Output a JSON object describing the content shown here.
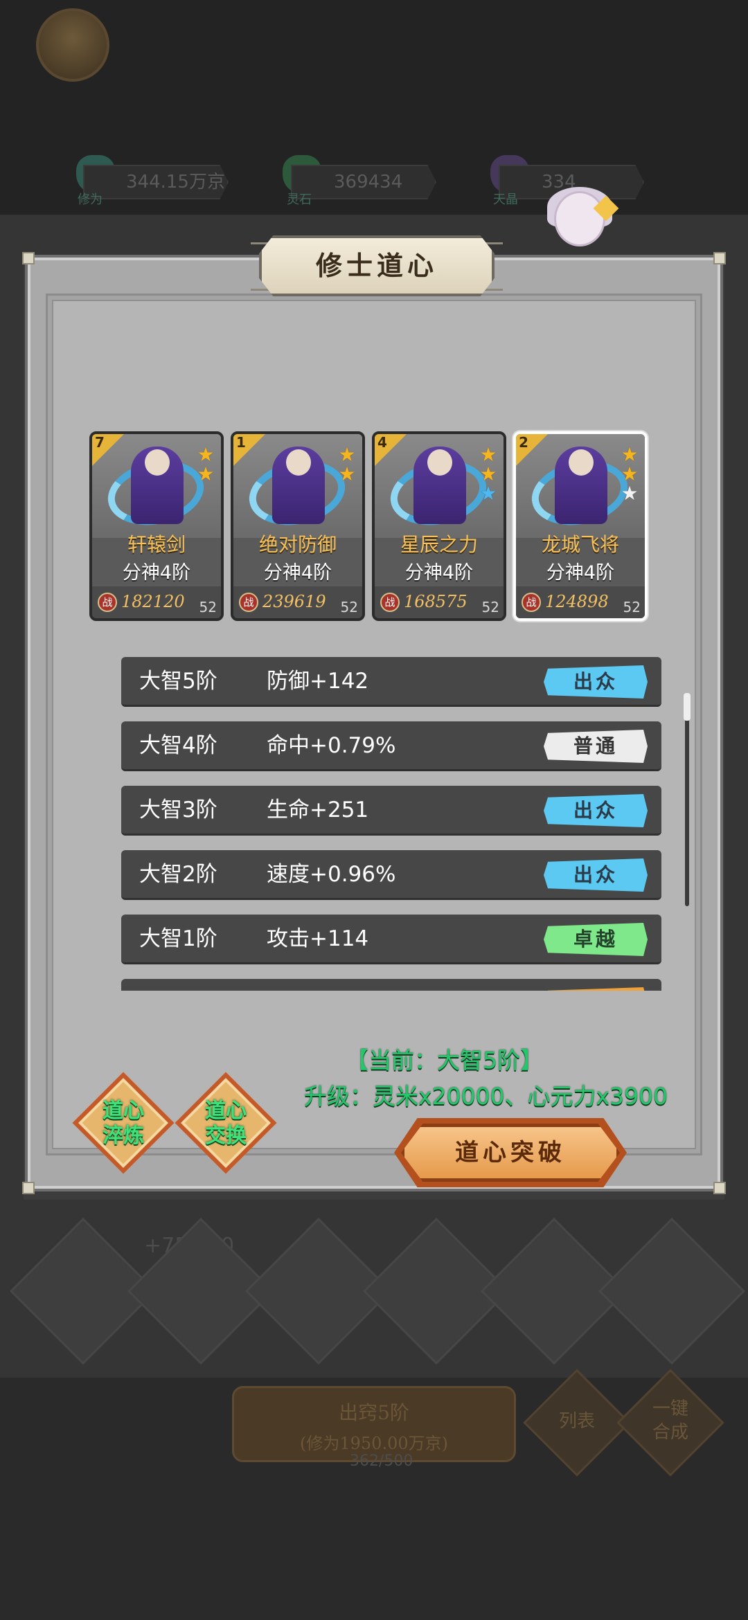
{
  "background": {
    "resources": [
      {
        "value": "344.15万京",
        "label": "修为",
        "color": "#3d7f73"
      },
      {
        "value": "369434",
        "label": "灵石",
        "color": "#3e7a52"
      },
      {
        "value": "334",
        "label": "天晶",
        "color": "#5d4a7a"
      }
    ],
    "power_text": "+75 460",
    "bottom_button_line1": "出窍5阶",
    "bottom_button_line2": "(修为1950.00万京)",
    "list_button": "列表",
    "merge_button": "一键合成",
    "exp_text": "362/500"
  },
  "dialog": {
    "title": "修士道心",
    "cards": [
      {
        "rank": "7",
        "name": "轩辕剑",
        "stage": "分神4阶",
        "power": "182120",
        "level": "52",
        "stars": [
          "gold",
          "gold"
        ],
        "selected": false
      },
      {
        "rank": "1",
        "name": "绝对防御",
        "stage": "分神4阶",
        "power": "239619",
        "level": "52",
        "stars": [
          "gold",
          "gold"
        ],
        "selected": false
      },
      {
        "rank": "4",
        "name": "星辰之力",
        "stage": "分神4阶",
        "power": "168575",
        "level": "52",
        "stars": [
          "gold",
          "gold",
          "blue"
        ],
        "selected": false
      },
      {
        "rank": "2",
        "name": "龙城飞将",
        "stage": "分神4阶",
        "power": "124898",
        "level": "52",
        "stars": [
          "gold",
          "gold",
          "white"
        ],
        "selected": true
      }
    ],
    "power_icon_text": "战",
    "rows": [
      {
        "stage": "大智5阶",
        "effect": "防御+142",
        "quality": "出众",
        "quality_color": "blue"
      },
      {
        "stage": "大智4阶",
        "effect": "命中+0.79%",
        "quality": "普通",
        "quality_color": "white"
      },
      {
        "stage": "大智3阶",
        "effect": "生命+251",
        "quality": "出众",
        "quality_color": "blue"
      },
      {
        "stage": "大智2阶",
        "effect": "速度+0.96%",
        "quality": "出众",
        "quality_color": "blue"
      },
      {
        "stage": "大智1阶",
        "effect": "攻击+114",
        "quality": "卓越",
        "quality_color": "green"
      },
      {
        "stage": "",
        "effect": "",
        "quality": "",
        "quality_color": "orange"
      }
    ],
    "current_text": "【当前：大智5阶】",
    "upgrade_text": "升级：灵米x20000、心元力x3900",
    "refine_button": "道心淬炼",
    "exchange_button": "道心交换",
    "breakthrough_button": "道心突破"
  }
}
